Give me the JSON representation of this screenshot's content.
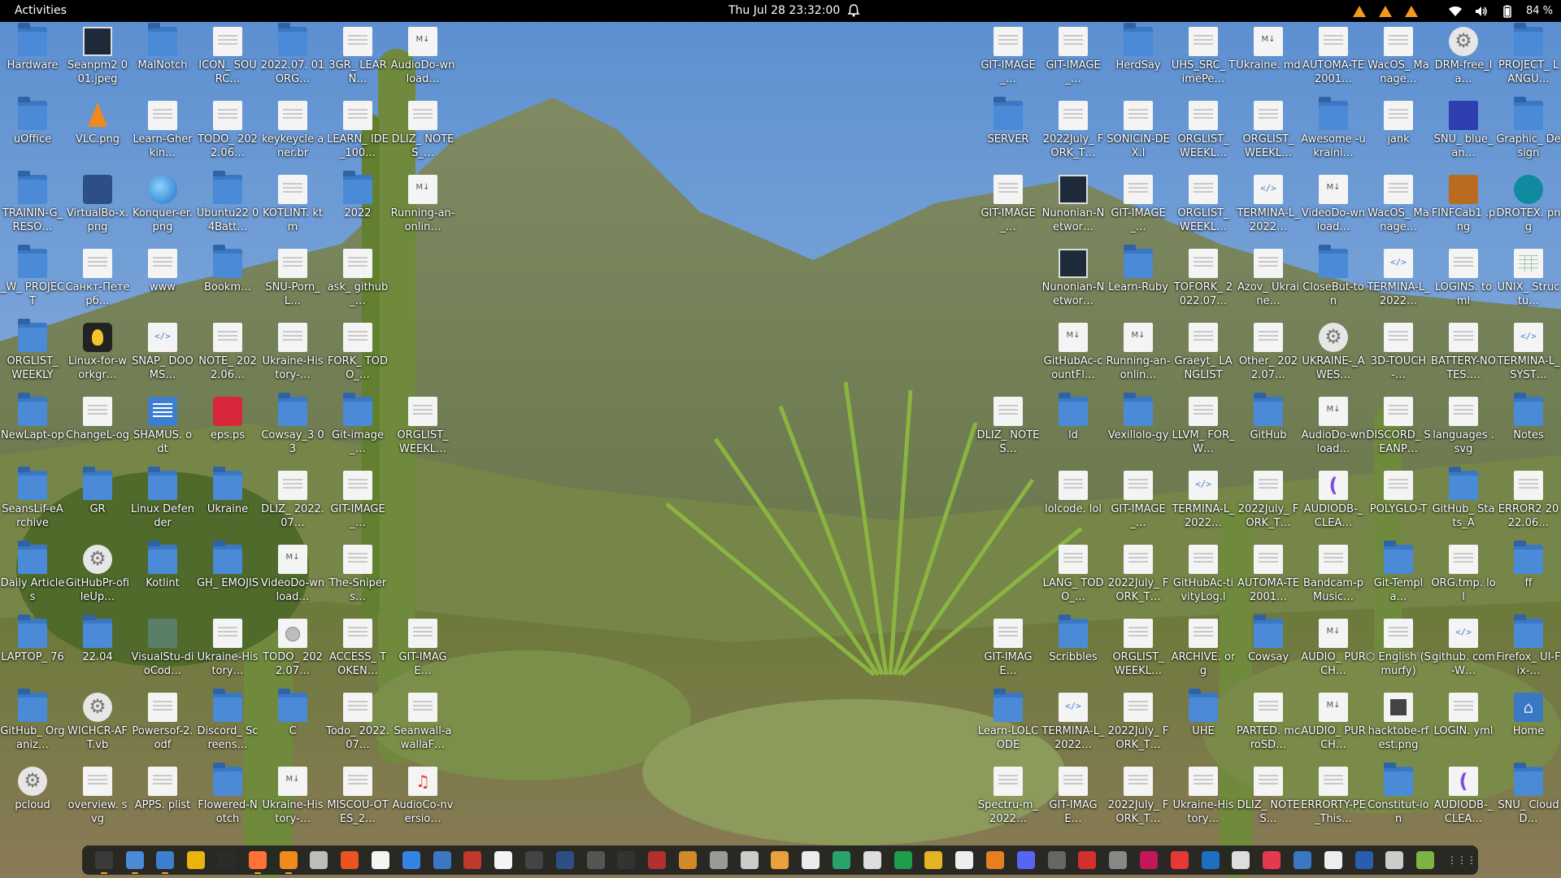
{
  "topbar": {
    "activities_label": "Activities",
    "clock": "Thu Jul 28  23:32:00",
    "battery_percent": "84 %",
    "tray_icons": [
      "warning-icon",
      "warning-icon",
      "warning-icon",
      "wifi-icon",
      "volume-icon",
      "battery-icon"
    ]
  },
  "desktop": {
    "left_columns": [
      [
        {
          "label": "Hardware",
          "icon": "folder"
        },
        {
          "label": "uOffice",
          "icon": "folder"
        },
        {
          "label": "TRAININ-G_RESO…",
          "icon": "folder"
        },
        {
          "label": "_W_ PROJECT",
          "icon": "folder"
        },
        {
          "label": "ORGLIST_ WEEKLY",
          "icon": "folder"
        },
        {
          "label": "NewLapt-op",
          "icon": "folder"
        },
        {
          "label": "SeansLif-eArchive",
          "icon": "folder"
        },
        {
          "label": "Daily Articles",
          "icon": "folder"
        },
        {
          "label": "LAPTOP_ 76",
          "icon": "folder"
        },
        {
          "label": "GitHub_ Organiz…",
          "icon": "folder"
        },
        {
          "label": "pcloud",
          "icon": "gear"
        }
      ],
      [
        {
          "label": "Seanpm2 001.jpeg",
          "icon": "image"
        },
        {
          "label": "VLC.png",
          "icon": "vlc"
        },
        {
          "label": "VirtualBo-x.png",
          "icon": "cube"
        },
        {
          "label": "Санкт-Петерб…",
          "icon": "file"
        },
        {
          "label": "Linux-for-workgr…",
          "icon": "tux"
        },
        {
          "label": "ChangeL-og",
          "icon": "file"
        },
        {
          "label": "GR",
          "icon": "folder"
        },
        {
          "label": "GitHubPr-ofileUp…",
          "icon": "gear"
        },
        {
          "label": "22.04",
          "icon": "folder"
        },
        {
          "label": "WICHCR-AFT.vb",
          "icon": "gear"
        },
        {
          "label": "overview. svg",
          "icon": "file"
        }
      ],
      [
        {
          "label": "MalNotch",
          "icon": "folder"
        },
        {
          "label": "Learn-Gherkin…",
          "icon": "file"
        },
        {
          "label": "Konquer-er.png",
          "icon": "globe"
        },
        {
          "label": "www",
          "icon": "file"
        },
        {
          "label": "SNAP_ DOOMS…",
          "icon": "code"
        },
        {
          "label": "SHAMUS. odt",
          "icon": "doc"
        },
        {
          "label": "Linux Defender",
          "icon": "folder"
        },
        {
          "label": "Kotlint",
          "icon": "folder"
        },
        {
          "label": "VisualStu-dioCod…",
          "icon": "vscode"
        },
        {
          "label": "Powersof-2.odf",
          "icon": "file"
        },
        {
          "label": "APPS. plist",
          "icon": "file"
        }
      ],
      [
        {
          "label": "ICON_ SOURC…",
          "icon": "file"
        },
        {
          "label": "TODO_ 2022.06…",
          "icon": "file"
        },
        {
          "label": "Ubuntu22 04Batt…",
          "icon": "folder"
        },
        {
          "label": "Bookm…",
          "icon": "folder"
        },
        {
          "label": "NOTE_ 2022.06…",
          "icon": "file"
        },
        {
          "label": "eps.ps",
          "icon": "red"
        },
        {
          "label": "Ukraine",
          "icon": "folder"
        },
        {
          "label": "GH_ EMOJIS",
          "icon": "folder"
        },
        {
          "label": "Ukraine-History…",
          "icon": "file"
        },
        {
          "label": "Discord_ Screens…",
          "icon": "folder"
        },
        {
          "label": "Flowered-Notch",
          "icon": "folder"
        }
      ],
      [
        {
          "label": "2022.07. 01ORG…",
          "icon": "folder"
        },
        {
          "label": "keykeycle aner.br",
          "icon": "file"
        },
        {
          "label": "KOTLINT. ktm",
          "icon": "file"
        },
        {
          "label": "SNU-Porn_L…",
          "icon": "file"
        },
        {
          "label": "Ukraine-History-…",
          "icon": "file"
        },
        {
          "label": "Cowsay_3 03",
          "icon": "folder"
        },
        {
          "label": "DLIZ_ 2022.07…",
          "icon": "file"
        },
        {
          "label": "VideoDo-wnload…",
          "icon": "md"
        },
        {
          "label": "TODO_ 2022.07…",
          "icon": "disc"
        },
        {
          "label": "C",
          "icon": "folder"
        },
        {
          "label": "Ukraine-History-…",
          "icon": "md"
        }
      ],
      [
        {
          "label": "3GR_ LEARN…",
          "icon": "file"
        },
        {
          "label": "LEARN_ IDE_100…",
          "icon": "file"
        },
        {
          "label": "2022",
          "icon": "folder"
        },
        {
          "label": "ask_ github_…",
          "icon": "file"
        },
        {
          "label": "FORK_ TODO_…",
          "icon": "file"
        },
        {
          "label": "Git-image_…",
          "icon": "folder"
        },
        {
          "label": "GIT-IMAGE_…",
          "icon": "file"
        },
        {
          "label": "The-Snipers…",
          "icon": "file"
        },
        {
          "label": "ACCESS_ TOKEN…",
          "icon": "file"
        },
        {
          "label": "Todo_ 2022.07…",
          "icon": "file"
        },
        {
          "label": "MISCOU-OTES_2…",
          "icon": "file"
        }
      ],
      [
        {
          "label": "AudioDo-wnload…",
          "icon": "md"
        },
        {
          "label": "DLIZ_ NOTES_…",
          "icon": "file"
        },
        {
          "label": "Running-an-onlin…",
          "icon": "md"
        },
        {
          "label": "",
          "icon": "none"
        },
        {
          "label": "",
          "icon": "none"
        },
        {
          "label": "ORGLIST_ WEEKL…",
          "icon": "file"
        },
        {
          "label": "",
          "icon": "none"
        },
        {
          "label": "",
          "icon": "none"
        },
        {
          "label": "GIT-IMAGE…",
          "icon": "file"
        },
        {
          "label": "Seanwall-awallaF…",
          "icon": "file"
        },
        {
          "label": "AudioCo-nversio…",
          "icon": "music"
        }
      ]
    ],
    "right_columns": [
      [
        {
          "label": "GIT-IMAGE_…",
          "icon": "file"
        },
        {
          "label": "SERVER",
          "icon": "folder"
        },
        {
          "label": "GIT-IMAGE_…",
          "icon": "file"
        },
        {
          "label": "",
          "icon": "none"
        },
        {
          "label": "",
          "icon": "none"
        },
        {
          "label": "DLIZ_ NOTES…",
          "icon": "file"
        },
        {
          "label": "",
          "icon": "none"
        },
        {
          "label": "",
          "icon": "none"
        },
        {
          "label": "GIT-IMAGE…",
          "icon": "file"
        },
        {
          "label": "Learn-LOLCODE",
          "icon": "folder"
        },
        {
          "label": "Spectru-m_2022…",
          "icon": "file"
        }
      ],
      [
        {
          "label": "GIT-IMAGE_…",
          "icon": "file"
        },
        {
          "label": "2022July_ FORK_T…",
          "icon": "file"
        },
        {
          "label": "Nunonian-Networ…",
          "icon": "image"
        },
        {
          "label": "Nunonian-Networ…",
          "icon": "image"
        },
        {
          "label": "GitHubAc-countFl…",
          "icon": "md"
        },
        {
          "label": "ld",
          "icon": "folder"
        },
        {
          "label": "lolcode. lol",
          "icon": "file"
        },
        {
          "label": "LANG_ TODO_…",
          "icon": "file"
        },
        {
          "label": "Scribbles",
          "icon": "folder"
        },
        {
          "label": "TERMINA-L_2022…",
          "icon": "code"
        },
        {
          "label": "GIT-IMAGE…",
          "icon": "file"
        }
      ],
      [
        {
          "label": "HerdSay",
          "icon": "folder"
        },
        {
          "label": "SONICIN-DEX.l",
          "icon": "file"
        },
        {
          "label": "GIT-IMAGE_…",
          "icon": "file"
        },
        {
          "label": "Learn-Ruby",
          "icon": "folder"
        },
        {
          "label": "Running-an-onlin…",
          "icon": "md"
        },
        {
          "label": "Vexillolo-gy",
          "icon": "folder"
        },
        {
          "label": "GIT-IMAGE_…",
          "icon": "file"
        },
        {
          "label": "2022July_ FORK_T…",
          "icon": "file"
        },
        {
          "label": "ORGLIST_ WEEKL…",
          "icon": "file"
        },
        {
          "label": "2022July_ FORK_T…",
          "icon": "file"
        },
        {
          "label": "2022July_ FORK_T…",
          "icon": "file"
        }
      ],
      [
        {
          "label": "UHS_SRC_ TimePe…",
          "icon": "file"
        },
        {
          "label": "ORGLIST_ WEEKL…",
          "icon": "file"
        },
        {
          "label": "ORGLIST_ WEEKL…",
          "icon": "file"
        },
        {
          "label": "TOFORK_ 2022.07…",
          "icon": "file"
        },
        {
          "label": "Graeyt_ LANGLIST",
          "icon": "file"
        },
        {
          "label": "LLVM_ FOR_W…",
          "icon": "file"
        },
        {
          "label": "TERMINA-L_2022…",
          "icon": "code"
        },
        {
          "label": "GitHubAc-tivityLog.l",
          "icon": "file"
        },
        {
          "label": "ARCHIVE. org",
          "icon": "file"
        },
        {
          "label": "UHE",
          "icon": "folder"
        },
        {
          "label": "Ukraine-History…",
          "icon": "file"
        }
      ],
      [
        {
          "label": "Ukraine. md",
          "icon": "md"
        },
        {
          "label": "ORGLIST_ WEEKL…",
          "icon": "file"
        },
        {
          "label": "TERMINA-L_2022…",
          "icon": "code"
        },
        {
          "label": "Azov_ Ukraine…",
          "icon": "file"
        },
        {
          "label": "Other_ 2022.07…",
          "icon": "file"
        },
        {
          "label": "GitHub",
          "icon": "folder"
        },
        {
          "label": "2022July_ FORK_T…",
          "icon": "file"
        },
        {
          "label": "AUTOMA-TE2001…",
          "icon": "file"
        },
        {
          "label": "Cowsay",
          "icon": "folder"
        },
        {
          "label": "PARTED. mcroSD…",
          "icon": "file"
        },
        {
          "label": "DLIZ_ NOTES…",
          "icon": "file"
        }
      ],
      [
        {
          "label": "AUTOMA-TE2001…",
          "icon": "file"
        },
        {
          "label": "Awesome -ukraini…",
          "icon": "folder"
        },
        {
          "label": "VideoDo-wnload…",
          "icon": "md"
        },
        {
          "label": "CloseBut-ton",
          "icon": "folder"
        },
        {
          "label": "UKRAINE-_AWES…",
          "icon": "gear"
        },
        {
          "label": "AudioDo-wnload…",
          "icon": "md"
        },
        {
          "label": "AUDIODB-_CLEA…",
          "icon": "purple"
        },
        {
          "label": "Bandcam-pMusic…",
          "icon": "file"
        },
        {
          "label": "AUDIO_ PURCH…",
          "icon": "md"
        },
        {
          "label": "AUDIO_ PURCH…",
          "icon": "md"
        },
        {
          "label": "ERRORTY-PE_This…",
          "icon": "file"
        }
      ],
      [
        {
          "label": "WacOS_ Manage…",
          "icon": "file"
        },
        {
          "label": "jank",
          "icon": "file"
        },
        {
          "label": "WacOS_ Manage…",
          "icon": "file"
        },
        {
          "label": "TERMINA-L_2022…",
          "icon": "code"
        },
        {
          "label": "3D-TOUCH-…",
          "icon": "file"
        },
        {
          "label": "DISCORD_ SEANP…",
          "icon": "file"
        },
        {
          "label": "POLYGLO-T",
          "icon": "file"
        },
        {
          "label": "Git-Templa…",
          "icon": "folder"
        },
        {
          "label": "⬡ English (Smurfy)",
          "icon": "file"
        },
        {
          "label": "hacktobe-rfest.png",
          "icon": "photo"
        },
        {
          "label": "Constitut-ion",
          "icon": "folder"
        }
      ],
      [
        {
          "label": "DRM-free_la…",
          "icon": "gear"
        },
        {
          "label": "SNU_ blue_an…",
          "icon": "book"
        },
        {
          "label": "FINFCab1 .png",
          "icon": "stack"
        },
        {
          "label": "LOGINS. toml",
          "icon": "file"
        },
        {
          "label": "BATTERY-NOTES.…",
          "icon": "file"
        },
        {
          "label": "languages .svg",
          "icon": "file"
        },
        {
          "label": "GitHub_ Stats_A",
          "icon": "folder"
        },
        {
          "label": "ORG.tmp. lol",
          "icon": "file"
        },
        {
          "label": "github. com-W…",
          "icon": "code"
        },
        {
          "label": "LOGIN. yml",
          "icon": "file"
        },
        {
          "label": "AUDIODB-_CLEA…",
          "icon": "purple"
        }
      ],
      [
        {
          "label": "PROJECT_ LANGU…",
          "icon": "folder"
        },
        {
          "label": "Graphic_ Design",
          "icon": "folder"
        },
        {
          "label": "DROTEX. png",
          "icon": "drop"
        },
        {
          "label": "UNIX_ Structu…",
          "icon": "sheet"
        },
        {
          "label": "TERMINA-L_SYST…",
          "icon": "code"
        },
        {
          "label": "Notes",
          "icon": "folder"
        },
        {
          "label": "ERROR2 2022.06…",
          "icon": "file"
        },
        {
          "label": "ff",
          "icon": "folder"
        },
        {
          "label": "Firefox_ UI-Fix-…",
          "icon": "folder"
        },
        {
          "label": "Home",
          "icon": "home"
        },
        {
          "label": "SNU_ CloudD…",
          "icon": "folder"
        }
      ]
    ]
  },
  "dock": {
    "apps": [
      {
        "name": "terminal-app-icon",
        "color": "#3a3a3a",
        "running": true
      },
      {
        "name": "files-app-icon",
        "color": "#4a8ad6",
        "running": true
      },
      {
        "name": "text-editor-app-icon",
        "color": "#3d7ed1",
        "running": true
      },
      {
        "name": "libreoffice-app-icon",
        "color": "#e8b50f",
        "running": false
      },
      {
        "name": "terminal-2-app-icon",
        "color": "#2b2b2b",
        "running": false
      },
      {
        "name": "firefox-app-icon",
        "color": "#ff7139",
        "running": true
      },
      {
        "name": "vlc-app-icon",
        "color": "#f08a1c",
        "running": true
      },
      {
        "name": "settings-app-icon",
        "color": "#bdbdbd",
        "running": false
      },
      {
        "name": "software-app-icon",
        "color": "#e95420",
        "running": false
      },
      {
        "name": "notes-app-icon",
        "color": "#f4f4f4",
        "running": false
      },
      {
        "name": "calendar-app-icon",
        "color": "#3584e4",
        "running": false
      },
      {
        "name": "help-app-icon",
        "color": "#3b78c4",
        "running": false
      },
      {
        "name": "monitor-app-icon",
        "color": "#c0392b",
        "running": false
      },
      {
        "name": "document-app-icon",
        "color": "#f4f4f4",
        "running": false
      },
      {
        "name": "android-app-icon",
        "color": "#444444",
        "running": false
      },
      {
        "name": "cube-app-icon",
        "color": "#2c4f85",
        "running": false
      },
      {
        "name": "steam-app-icon",
        "color": "#555555",
        "running": false
      },
      {
        "name": "up-arrow-app-icon",
        "color": "#333333",
        "running": false
      },
      {
        "name": "red-app-icon",
        "color": "#b03030",
        "running": false
      },
      {
        "name": "star-app-icon",
        "color": "#d08a2a",
        "running": false
      },
      {
        "name": "gray-app-icon",
        "color": "#9a9a9a",
        "running": false
      },
      {
        "name": "search-app-icon",
        "color": "#cccccc",
        "running": false
      },
      {
        "name": "chrome-app-icon",
        "color": "#e9a23b",
        "running": false
      },
      {
        "name": "book-app-icon",
        "color": "#ececec",
        "running": false
      },
      {
        "name": "green-app-icon",
        "color": "#2aa36b",
        "running": false
      },
      {
        "name": "camera-app-icon",
        "color": "#dddddd",
        "running": false
      },
      {
        "name": "spreadsheet-app-icon",
        "color": "#1e9d4a",
        "running": false
      },
      {
        "name": "yellow-app-icon",
        "color": "#e6b422",
        "running": false
      },
      {
        "name": "print-app-icon",
        "color": "#eeeeee",
        "running": false
      },
      {
        "name": "orange-app-icon",
        "color": "#e67e22",
        "running": false
      },
      {
        "name": "discord-app-icon",
        "color": "#5865f2",
        "running": false
      },
      {
        "name": "circle-app-icon",
        "color": "#666666",
        "running": false
      },
      {
        "name": "pdf-app-icon",
        "color": "#d32f2f",
        "running": false
      },
      {
        "name": "percent-app-icon",
        "color": "#888888",
        "running": false
      },
      {
        "name": "pink-app-icon",
        "color": "#c2185b",
        "running": false
      },
      {
        "name": "media-app-icon",
        "color": "#e53935",
        "running": false
      },
      {
        "name": "code-app-icon",
        "color": "#1e6fc4",
        "running": false
      },
      {
        "name": "github-app-icon",
        "color": "#dddddd",
        "running": false
      },
      {
        "name": "pocket-app-icon",
        "color": "#e53950",
        "running": false
      },
      {
        "name": "blue-app-icon",
        "color": "#3b78c4",
        "running": false
      },
      {
        "name": "white-app-icon",
        "color": "#eeeeee",
        "running": false
      },
      {
        "name": "blue-2-app-icon",
        "color": "#2a5db0",
        "running": false
      },
      {
        "name": "disk-app-icon",
        "color": "#cccccc",
        "running": false
      },
      {
        "name": "android-2-app-icon",
        "color": "#7cb342",
        "running": false
      }
    ],
    "show_apps_label": "⋮⋮⋮"
  }
}
